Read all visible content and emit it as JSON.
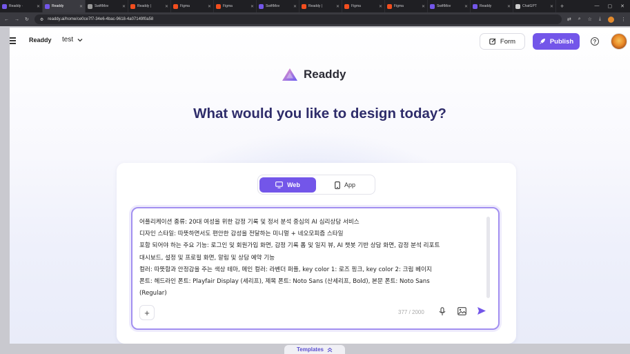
{
  "browser": {
    "tabs": [
      {
        "title": "Readdy ·",
        "fav_color": "#7356e9",
        "active": false
      },
      {
        "title": "Readdy",
        "fav_color": "#7356e9",
        "active": true
      },
      {
        "title": "SwiftMov",
        "fav_color": "#999999",
        "active": false
      },
      {
        "title": "Readdy |",
        "fav_color": "#f24e1e",
        "active": false
      },
      {
        "title": "Figma",
        "fav_color": "#f24e1e",
        "active": false
      },
      {
        "title": "Figma",
        "fav_color": "#f24e1e",
        "active": false
      },
      {
        "title": "SwiftMov",
        "fav_color": "#7356e9",
        "active": false
      },
      {
        "title": "Readdy |",
        "fav_color": "#f24e1e",
        "active": false
      },
      {
        "title": "Figma",
        "fav_color": "#f24e1e",
        "active": false
      },
      {
        "title": "Figma",
        "fav_color": "#f24e1e",
        "active": false
      },
      {
        "title": "SwiftMov",
        "fav_color": "#7356e9",
        "active": false
      },
      {
        "title": "Readdy",
        "fav_color": "#7356e9",
        "active": false
      },
      {
        "title": "ChatGPT",
        "fav_color": "#cccccc",
        "active": false
      }
    ],
    "url": "readdy.ai/home/ce0ce7f7-34e6-4bac-9618-4a07149f0a58"
  },
  "header": {
    "brand": "Readdy",
    "project": "test",
    "form_label": "Form",
    "publish_label": "Publish",
    "help_label": "?"
  },
  "hero": {
    "logo_text": "Readdy",
    "title": "What would you like to design today?"
  },
  "mode_toggle": {
    "web_label": "Web",
    "app_label": "App"
  },
  "prompt": {
    "lines": [
      "어플리케이션 종류: 20대 여성을 위한 감정 기록 및 정서 분석 중심의 AI 심리상담 서비스",
      "디자인 스타일: 따뜻하면서도 편안한 감성을 전달하는 미니멀 + 네오모피즘 스타일",
      "포함 되어야 하는 주요 기능: 로그인 및 회원가입 화면, 감정 기록 폼 및 일지 뷰, AI 챗봇 기반 상담 화면, 감정 분석 리포트",
      "대시보드, 설정 및 프로필 화면, 알림 및 상담 예약 기능",
      "컬러: 따뜻함과 안정감을 주는 색상 테마, 메인 컬러: 라벤더 퍼플, key color 1: 로즈 핑크, key color 2: 크림 베이지",
      "폰트: 헤드라인 폰트: Playfair Display (세리프), 제목 폰트: Noto Sans (산세리프, Bold), 본문 폰트: Noto Sans",
      "(Regular)"
    ],
    "char_count": "377 / 2000"
  },
  "footer": {
    "templates_label": "Templates"
  }
}
